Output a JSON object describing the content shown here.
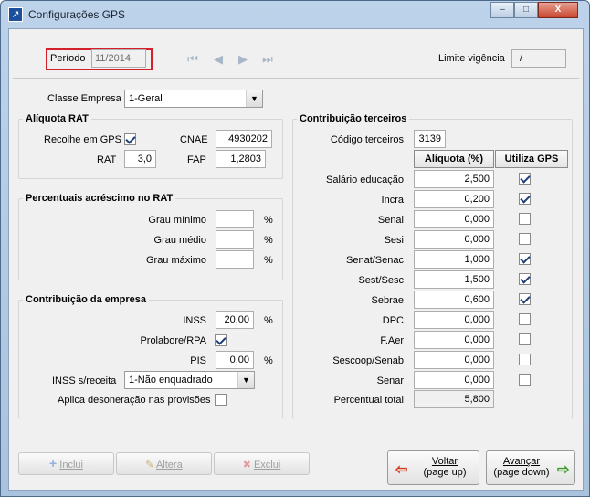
{
  "window": {
    "title": "Configurações GPS",
    "minimize": "–",
    "maximize": "□",
    "close": "X",
    "icon": "↗"
  },
  "header": {
    "periodo_label": "Período",
    "periodo_value": "11/2014",
    "nav": {
      "first": "⏮",
      "prev": "◀",
      "next": "▶",
      "last": "⏭"
    },
    "limite_label": "Limite vigência",
    "limite_value": "/"
  },
  "classe_empresa": {
    "label": "Classe Empresa",
    "value": "1-Geral",
    "arrow": "▼"
  },
  "aliquota_rat": {
    "title": "Alíquota RAT",
    "recolhe_label": "Recolhe em GPS",
    "recolhe_checked": true,
    "cnae_label": "CNAE",
    "cnae_value": "4930202",
    "rat_label": "RAT",
    "rat_value": "3,0",
    "fap_label": "FAP",
    "fap_value": "1,2803"
  },
  "percentuais": {
    "title": "Percentuais acréscimo no RAT",
    "rows": [
      {
        "label": "Grau mínimo",
        "value": "",
        "unit": "%"
      },
      {
        "label": "Grau médio",
        "value": "",
        "unit": "%"
      },
      {
        "label": "Grau máximo",
        "value": "",
        "unit": "%"
      }
    ]
  },
  "contribuicao_empresa": {
    "title": "Contribuição da empresa",
    "inss_label": "INSS",
    "inss_value": "20,00",
    "inss_unit": "%",
    "prolabore_label": "Prolabore/RPA",
    "prolabore_checked": true,
    "pis_label": "PIS",
    "pis_value": "0,00",
    "pis_unit": "%",
    "inss_receita_label": "INSS s/receita",
    "inss_receita_value": "1-Não enquadrado",
    "inss_receita_arrow": "▼",
    "desoneracao_label": "Aplica desoneração nas provisões",
    "desoneracao_checked": false
  },
  "terceiros": {
    "title": "Contribuição terceiros",
    "codigo_label": "Código terceiros",
    "codigo_value": "3139",
    "col_aliquota": "Alíquota (%)",
    "col_gps": "Utiliza GPS",
    "rows": [
      {
        "label": "Salário educação",
        "value": "2,500",
        "gps": true
      },
      {
        "label": "Incra",
        "value": "0,200",
        "gps": true
      },
      {
        "label": "Senai",
        "value": "0,000",
        "gps": false
      },
      {
        "label": "Sesi",
        "value": "0,000",
        "gps": false
      },
      {
        "label": "Senat/Senac",
        "value": "1,000",
        "gps": true
      },
      {
        "label": "Sest/Sesc",
        "value": "1,500",
        "gps": true
      },
      {
        "label": "Sebrae",
        "value": "0,600",
        "gps": true
      },
      {
        "label": "DPC",
        "value": "0,000",
        "gps": false
      },
      {
        "label": "F.Aer",
        "value": "0,000",
        "gps": false
      },
      {
        "label": "Sescoop/Senab",
        "value": "0,000",
        "gps": false
      },
      {
        "label": "Senar",
        "value": "0,000",
        "gps": false
      }
    ],
    "total_label": "Percentual total",
    "total_value": "5,800"
  },
  "buttons": {
    "inclui": "Inclui",
    "inclui_icon": "+",
    "altera": "Altera",
    "altera_icon": "✎",
    "exclui": "Exclui",
    "exclui_icon": "✖",
    "voltar": "Voltar",
    "voltar_sub": "(page up)",
    "voltar_icon": "⇦",
    "avancar": "Avançar",
    "avancar_sub": "(page down)",
    "avancar_icon": "⇨"
  },
  "colors": {
    "highlight_border": "#d4202a",
    "checkmark": "#1e3f78",
    "window_frame": "#a9c2de"
  }
}
